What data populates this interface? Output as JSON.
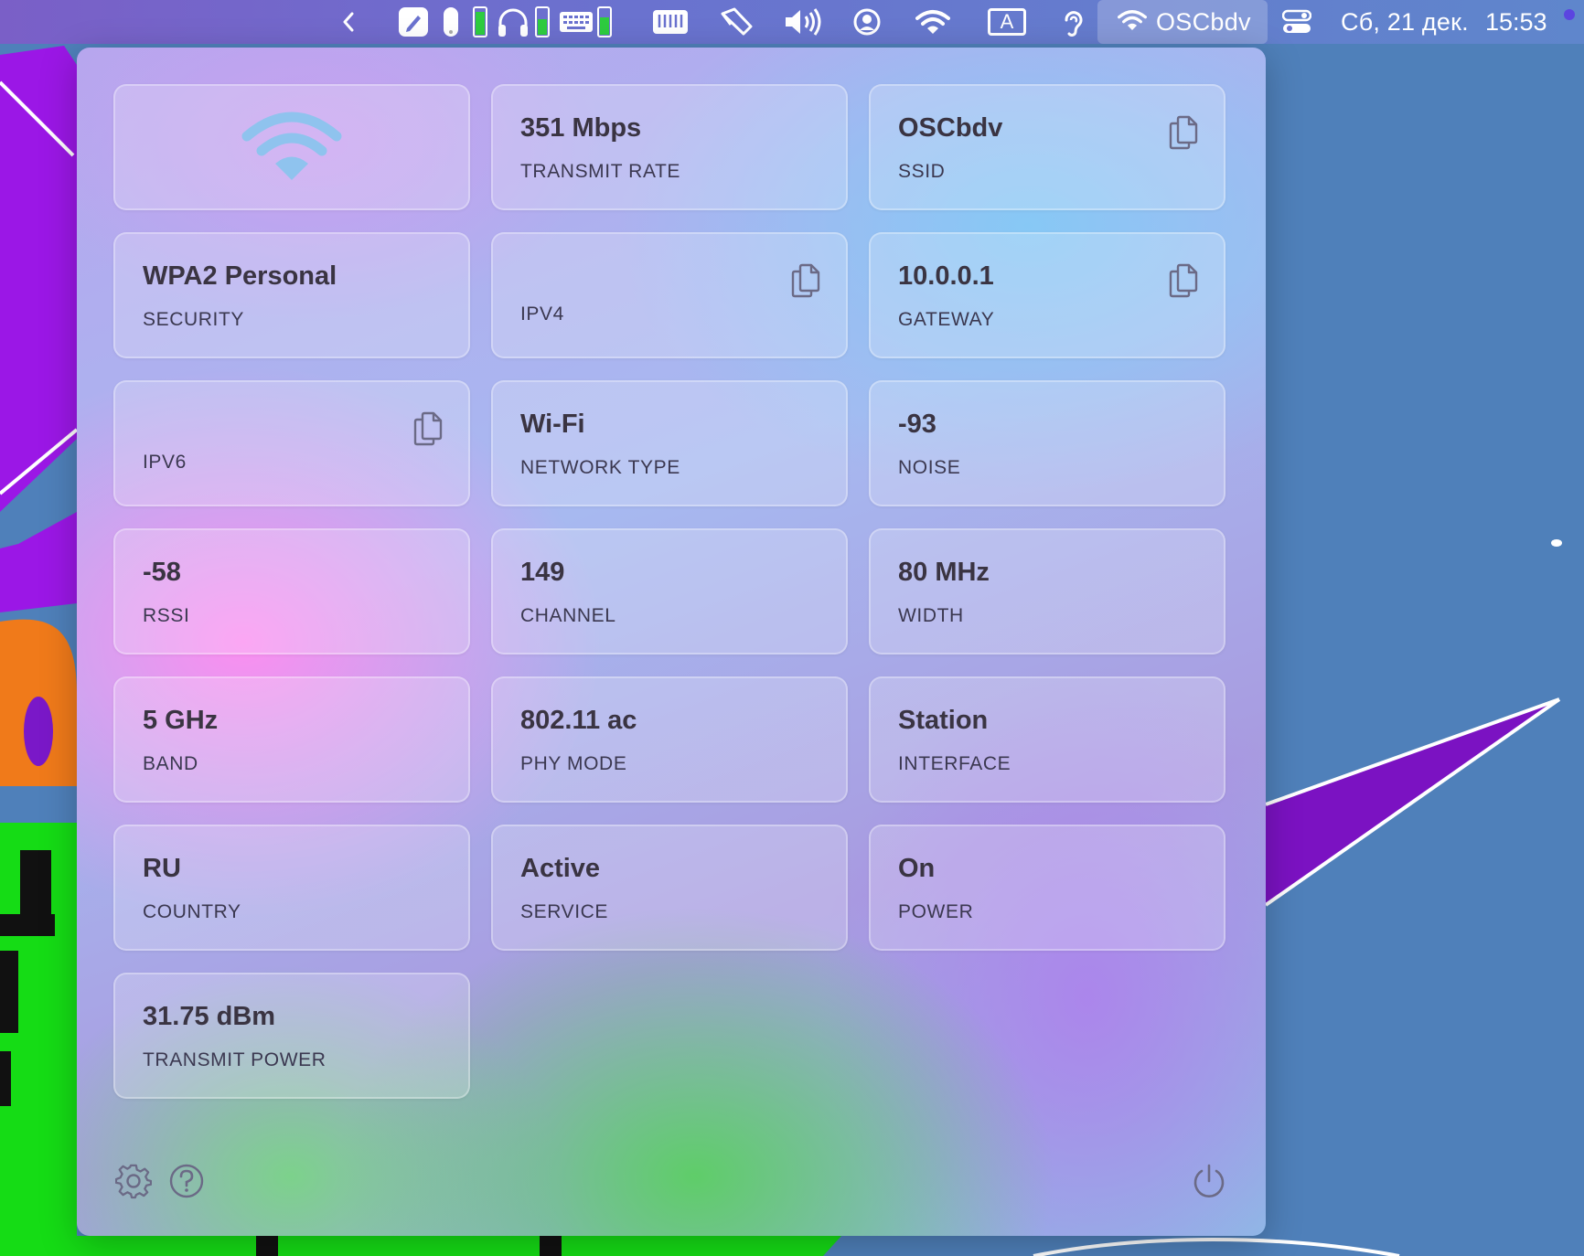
{
  "menubar": {
    "icons": [
      "chevron-left-icon",
      "pen-icon",
      "mouse-icon",
      "battery-low-icon",
      "headphones-icon",
      "battery-low-icon",
      "keyboard-icon",
      "battery-low-icon",
      "ruler-icon",
      "flashlight-icon",
      "volume-icon",
      "user-circle-icon",
      "wifi-icon",
      "input-source-icon",
      "hearing-icon"
    ],
    "input_source_letter": "A",
    "wifi_name": "OSCbdv",
    "date": "Сб, 21 дек.",
    "time": "15:53"
  },
  "tiles": [
    {
      "id": "wifi",
      "kind": "icon",
      "icon": "wifi-icon"
    },
    {
      "id": "transmit-rate",
      "value": "351 Mbps",
      "label": "TRANSMIT RATE",
      "copy": false
    },
    {
      "id": "ssid",
      "value": "OSCbdv",
      "label": "SSID",
      "copy": true
    },
    {
      "id": "security",
      "value": "WPA2 Personal",
      "label": "SECURITY",
      "copy": false
    },
    {
      "id": "ipv4",
      "value": "",
      "label": "IPV4",
      "copy": true
    },
    {
      "id": "gateway",
      "value": "10.0.0.1",
      "label": "GATEWAY",
      "copy": true
    },
    {
      "id": "ipv6",
      "value": "",
      "label": "IPV6",
      "copy": true
    },
    {
      "id": "network-type",
      "value": "Wi-Fi",
      "label": "NETWORK TYPE",
      "copy": false
    },
    {
      "id": "noise",
      "value": "-93",
      "label": "NOISE",
      "copy": false
    },
    {
      "id": "rssi",
      "value": "-58",
      "label": "RSSI",
      "copy": false
    },
    {
      "id": "channel",
      "value": "149",
      "label": "CHANNEL",
      "copy": false
    },
    {
      "id": "width",
      "value": "80 MHz",
      "label": "WIDTH",
      "copy": false
    },
    {
      "id": "band",
      "value": "5 GHz",
      "label": "BAND",
      "copy": false
    },
    {
      "id": "phy-mode",
      "value": "802.11 ac",
      "label": "PHY MODE",
      "copy": false
    },
    {
      "id": "interface",
      "value": "Station",
      "label": "INTERFACE",
      "copy": false
    },
    {
      "id": "country",
      "value": "RU",
      "label": "COUNTRY",
      "copy": false
    },
    {
      "id": "service",
      "value": "Active",
      "label": "SERVICE",
      "copy": false
    },
    {
      "id": "power",
      "value": "On",
      "label": "POWER",
      "copy": false
    },
    {
      "id": "transmit-power",
      "value": "31.75 dBm",
      "label": "TRANSMIT POWER",
      "copy": false
    }
  ],
  "footer": {
    "left_icons": [
      "gear-icon",
      "help-icon"
    ],
    "right_icon": "power-icon"
  },
  "colors": {
    "wifi_glyph": "#8fc3ee",
    "icon_stroke": "#6b6a86"
  }
}
